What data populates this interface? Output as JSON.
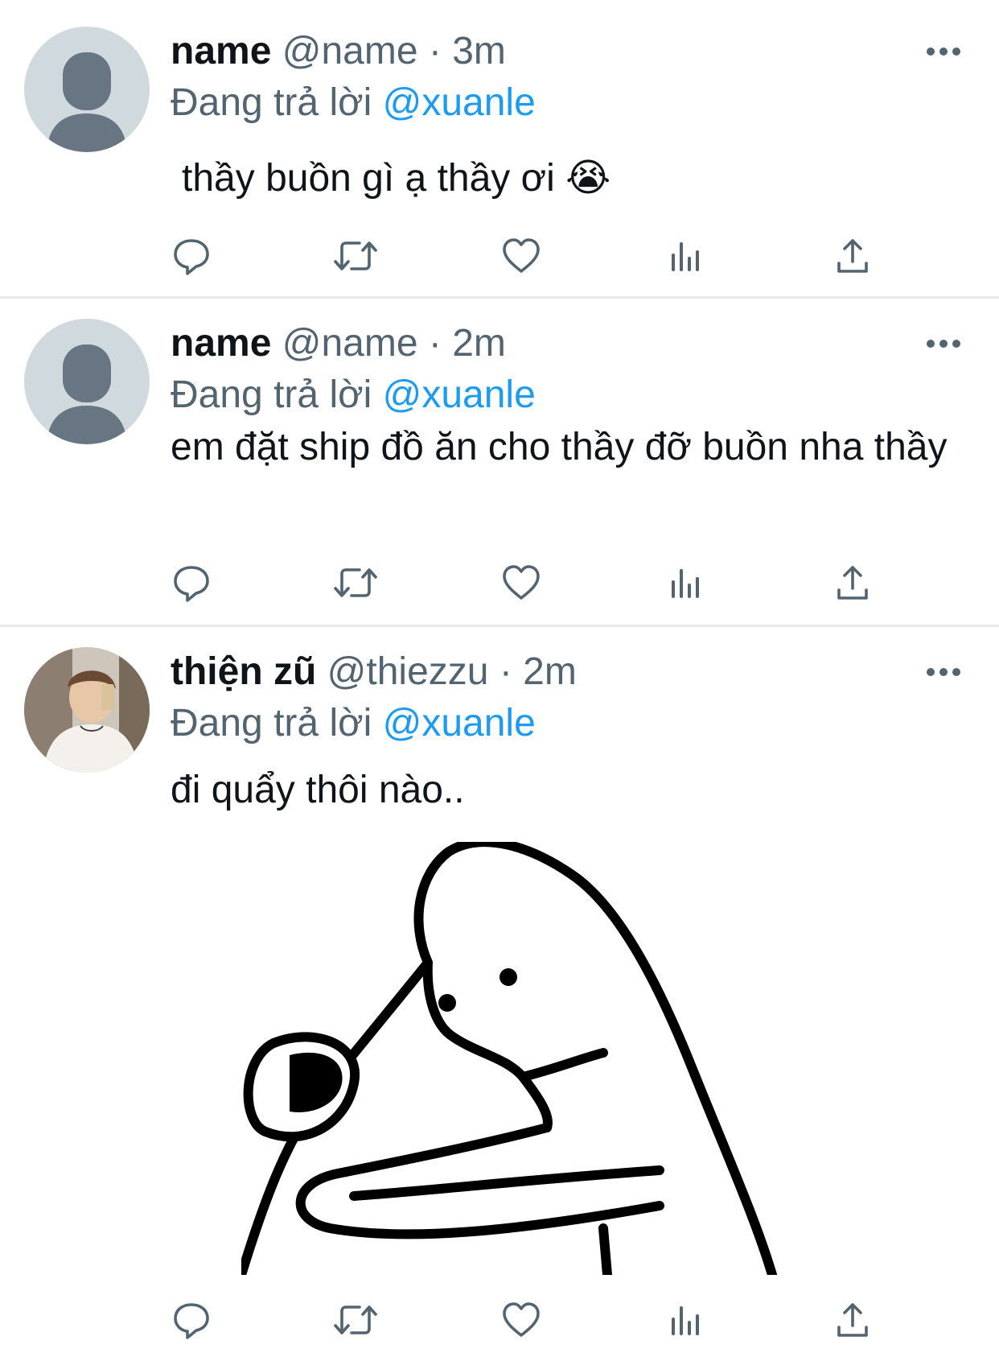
{
  "colors": {
    "text": "#0f1419",
    "secondary": "#536471",
    "link": "#1d9bf0",
    "divider": "#e7e9eb"
  },
  "icons": [
    "comment-icon",
    "retweet-icon",
    "like-icon",
    "stats-icon",
    "share-icon",
    "more-icon"
  ],
  "tweets": [
    {
      "display_name": "name",
      "handle": "@name",
      "separator": "·",
      "time": "3m",
      "reply_prefix": "Đang trả lời",
      "reply_to": "@xuanle",
      "text": "thầy buồn gì ạ thầy ơi 😭"
    },
    {
      "display_name": "name",
      "handle": "@name",
      "separator": "·",
      "time": "2m",
      "reply_prefix": "Đang trả lời",
      "reply_to": "@xuanle",
      "text": "em đặt ship đồ ăn cho thầy đỡ buồn nha thầy"
    },
    {
      "display_name": "thiện zũ",
      "handle": "@thiezzu",
      "separator": "·",
      "time": "2m",
      "reply_prefix": "Đang trả lời",
      "reply_to": "@xuanle",
      "text": "đi quẩy thôi nào.."
    }
  ]
}
